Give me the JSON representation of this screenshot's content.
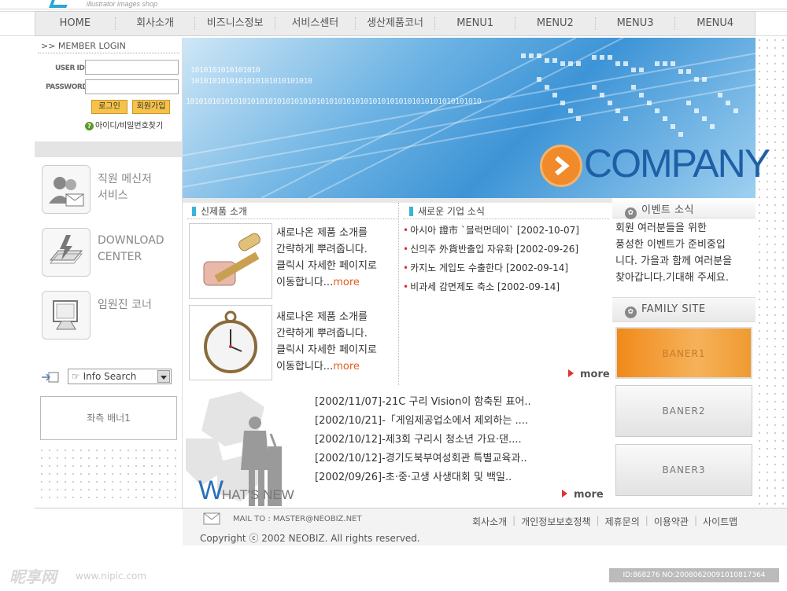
{
  "brand": {
    "tagline": "illustrator images shop"
  },
  "nav": {
    "items": [
      "HOME",
      "회사소개",
      "비즈니스정보",
      "서비스센터",
      "생산제품코너",
      "MENU1",
      "MENU2",
      "MENU3",
      "MENU4"
    ]
  },
  "login": {
    "title": ">> MEMBER LOGIN",
    "user_label": "USER ID",
    "pw_label": "PASSWORD",
    "user_value": "",
    "pw_value": "",
    "login_btn": "로그인",
    "join_btn": "회원가입",
    "find_link": "아이디/비밀번호찾기"
  },
  "left_menu": [
    {
      "line1": "직원 메신저",
      "line2": "서비스",
      "icon": "people-mail-icon"
    },
    {
      "line1": "DOWNLOAD",
      "line2": "CENTER",
      "icon": "download-icon"
    },
    {
      "line1": "임원진 코너",
      "line2": "",
      "icon": "monitor-icon"
    }
  ],
  "search": {
    "label": "Info Search"
  },
  "left_banner": {
    "label": "좌측 배너1"
  },
  "hero": {
    "binary1": "1010101010101010",
    "binary2": "1010101010101010101010101010",
    "binary3": "10101010101010101010101010101010101010101010101010101010101010101010",
    "company": "COMPANY"
  },
  "products": {
    "title": "신제품 소개",
    "items": [
      {
        "lines": [
          "새로나온 제품 소개를",
          "간략하게 뿌려줍니다.",
          "클릭시 자세한 페이지로",
          "이동합니다..."
        ],
        "more": "more",
        "icon": "roller-stamp-icon"
      },
      {
        "lines": [
          "새로나온 제품 소개를",
          "간략하게 뿌려줍니다.",
          "클릭시 자세한 페이지로",
          "이동합니다..."
        ],
        "more": "more",
        "icon": "pocket-watch-icon"
      }
    ]
  },
  "news": {
    "title": "새로운 기업 소식",
    "items": [
      {
        "text": "아시아 證市 `블럭먼데이`",
        "date": "[2002-10-07]"
      },
      {
        "text": "신의주 外貨반출입 자유화",
        "date": "[2002-09-26]"
      },
      {
        "text": "카지노 게입도 수출한다",
        "date": "[2002-09-14]"
      },
      {
        "text": "비과세 감면제도 축소",
        "date": "[2002-09-14]"
      }
    ],
    "more": "more"
  },
  "whatsnew": {
    "title_w": "W",
    "title_rest": "HAT'S NEW",
    "items": [
      "[2002/11/07]-21C 구리 Vision이 함축된 표어..",
      "[2002/10/21]-「게임제공업소에서 제외하는 ....",
      "[2002/10/12]-제3회 구리시 청소년 가요·댄....",
      "[2002/10/12]-경기도북부여성회관 특별교육과..",
      "[2002/09/26]-초·중·고생 사생대회 및 백일.."
    ],
    "more": "more"
  },
  "event": {
    "title": "이벤트 소식",
    "lines": [
      "회원 여러분들을 위한",
      "풍성한 이벤트가 준비중입",
      "니다. 가을과 함께 여러분을",
      "찾아갑니다.기대해 주세요."
    ]
  },
  "family": {
    "title": "FAMILY SITE"
  },
  "banners": [
    "BANER1",
    "BANER2",
    "BANER3"
  ],
  "footer": {
    "mail": "MAIL TO : MASTER@NEOBIZ.NET",
    "links": [
      "회사소개",
      "개인정보보호정책",
      "제휴문의",
      "이용약관",
      "사이트맵"
    ],
    "copyright": "Copyright ⓒ 2002 NEOBIZ. All rights reserved."
  },
  "watermark": {
    "logo": "昵享网",
    "url": "www.nipic.com",
    "id": "ID:868276 NO:20080620091010817364"
  },
  "colors": {
    "accent": "#3cb4d8",
    "orange": "#f08a2a",
    "company": "#1e5fa6",
    "more": "#e25d1e"
  }
}
